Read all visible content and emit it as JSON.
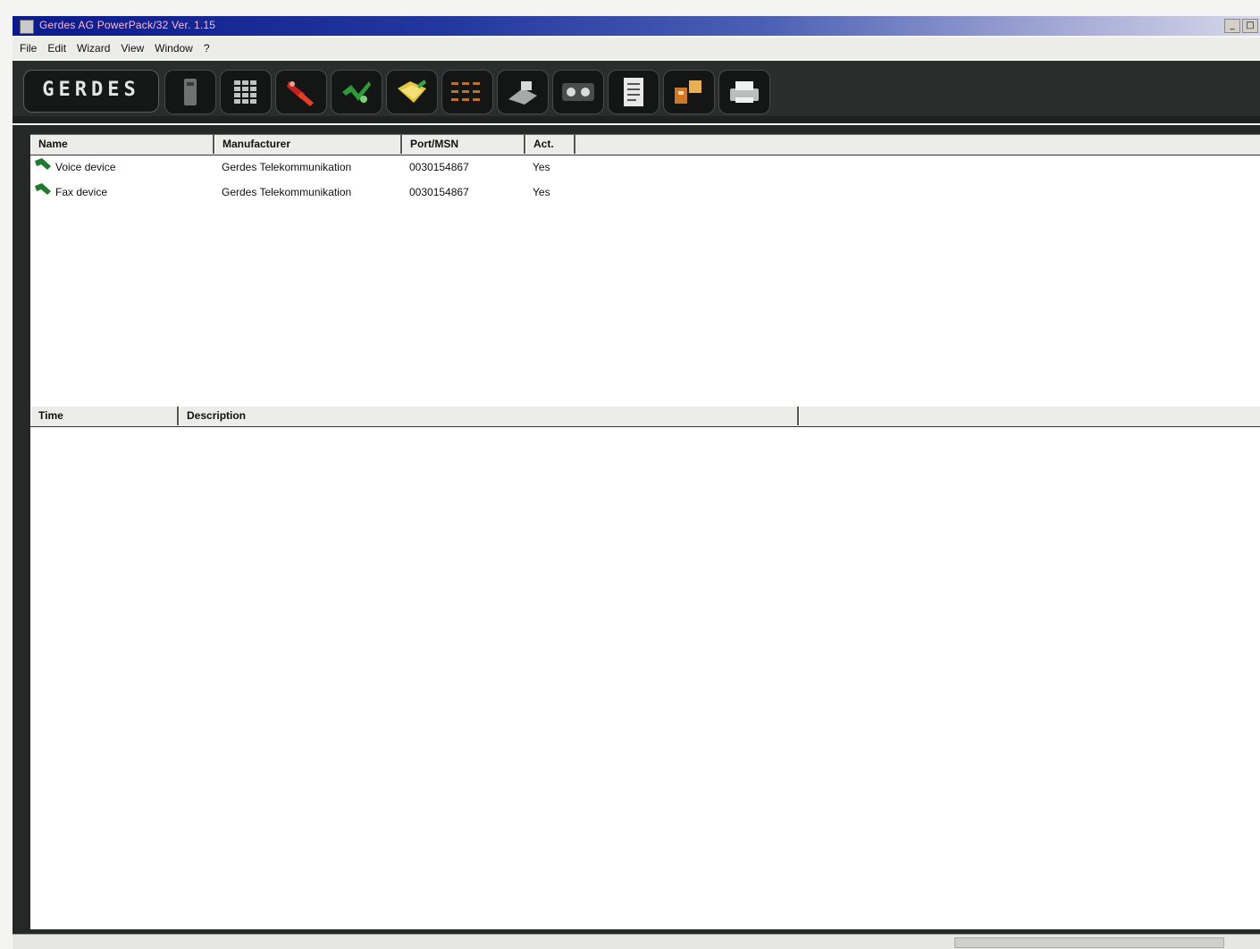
{
  "window": {
    "title": "Gerdes AG PowerPack/32 Ver. 1.15",
    "controls": [
      "_",
      "□"
    ]
  },
  "menu": [
    "File",
    "Edit",
    "Wizard",
    "View",
    "Window",
    "?"
  ],
  "toolbar": {
    "logo_text": "GERDES",
    "buttons": [
      {
        "icon": "phone-handset-icon"
      },
      {
        "icon": "keypad-icon"
      },
      {
        "icon": "red-connector-icon"
      },
      {
        "icon": "green-plug-icon"
      },
      {
        "icon": "yellow-folder-icon"
      },
      {
        "icon": "register-grid-icon"
      },
      {
        "icon": "fax-machine-icon"
      },
      {
        "icon": "tape-reels-icon"
      },
      {
        "icon": "document-icon"
      },
      {
        "icon": "transfer-icon"
      },
      {
        "icon": "printer-icon"
      }
    ]
  },
  "devices": {
    "columns": [
      "Name",
      "Manufacturer",
      "Port/MSN",
      "Act."
    ],
    "rows": [
      {
        "name": "Voice device",
        "manufacturer": "Gerdes Telekommunikation",
        "port": "0030154867",
        "active": "Yes"
      },
      {
        "name": "Fax device",
        "manufacturer": "Gerdes Telekommunikation",
        "port": "0030154867",
        "active": "Yes"
      }
    ]
  },
  "log": {
    "columns": [
      "Time",
      "Description"
    ]
  },
  "colors": {
    "title_start": "#0b1a8c",
    "title_end": "#d6d8ea",
    "toolbar_bg": "#2a2d2c",
    "device_icon": "#1f7a2e"
  }
}
